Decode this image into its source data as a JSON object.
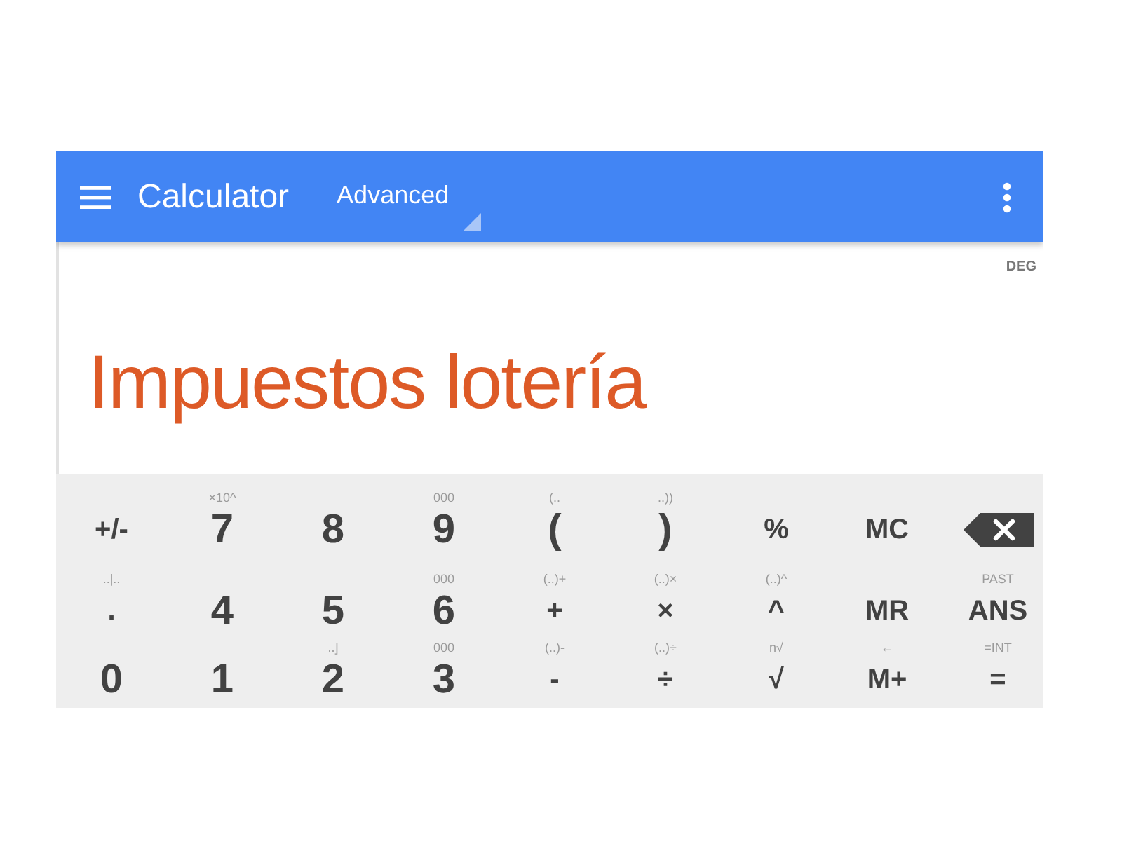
{
  "app_bar": {
    "title": "Calculator",
    "mode": "Advanced"
  },
  "display": {
    "angle_unit": "DEG",
    "expression": "Impuestos lotería"
  },
  "keypad": {
    "rows": [
      [
        {
          "kind": "function",
          "label": "+/-"
        },
        {
          "kind": "digit",
          "label": "7",
          "hint": "×10^"
        },
        {
          "kind": "digit",
          "label": "8"
        },
        {
          "kind": "digit",
          "label": "9",
          "hint": "000"
        },
        {
          "kind": "digit",
          "label": "(",
          "hint": "(.."
        },
        {
          "kind": "digit",
          "label": ")",
          "hint": "..))"
        },
        {
          "kind": "function",
          "label": "%"
        },
        {
          "kind": "function",
          "label": "MC"
        },
        {
          "kind": "backspace"
        }
      ],
      [
        {
          "kind": "function",
          "label": ".",
          "hint": "..|.."
        },
        {
          "kind": "digit",
          "label": "4"
        },
        {
          "kind": "digit",
          "label": "5"
        },
        {
          "kind": "digit",
          "label": "6",
          "hint": "000"
        },
        {
          "kind": "function",
          "label": "+",
          "hint": "(..)+"
        },
        {
          "kind": "function",
          "label": "×",
          "hint": "(..)×"
        },
        {
          "kind": "function",
          "label": "^",
          "hint": "(..)^"
        },
        {
          "kind": "function",
          "label": "MR"
        },
        {
          "kind": "function",
          "label": "ANS",
          "hint": "PAST"
        }
      ],
      [
        {
          "kind": "digit",
          "label": "0"
        },
        {
          "kind": "digit",
          "label": "1"
        },
        {
          "kind": "digit",
          "label": "2",
          "hint": "..]"
        },
        {
          "kind": "digit",
          "label": "3",
          "hint": "000"
        },
        {
          "kind": "function",
          "label": "-",
          "hint": "(..)-"
        },
        {
          "kind": "function",
          "label": "÷",
          "hint": "(..)÷"
        },
        {
          "kind": "function",
          "label": "√",
          "hint": "n√"
        },
        {
          "kind": "function",
          "label": "M+",
          "hint": "←"
        },
        {
          "kind": "function",
          "label": "=",
          "hint": "=INT"
        }
      ]
    ]
  }
}
